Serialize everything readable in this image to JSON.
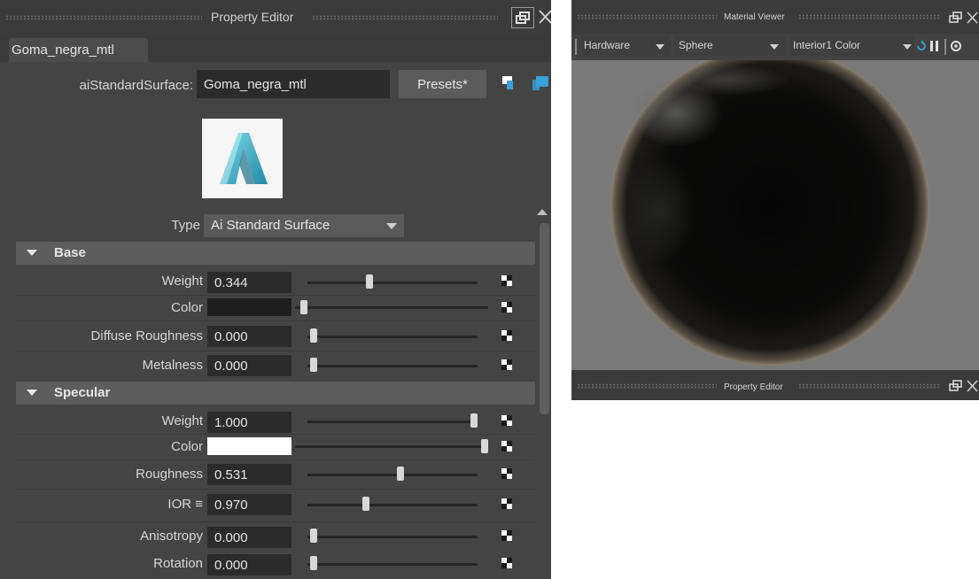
{
  "property_editor": {
    "title": "Property Editor",
    "tab_label": "Goma_negra_mtl",
    "node_type_label": "aiStandardSurface:",
    "node_name": "Goma_negra_mtl",
    "presets_label": "Presets*",
    "type_label": "Type",
    "type_value": "Ai Standard Surface",
    "sections": {
      "base": {
        "title": "Base",
        "weight": {
          "label": "Weight",
          "value": "0.344",
          "fraction": 0.344
        },
        "color": {
          "label": "Color",
          "swatch": "#1f1f1f",
          "fraction": 0.0
        },
        "diffuse_roughness": {
          "label": "Diffuse Roughness",
          "value": "0.000",
          "fraction": 0.0
        },
        "metalness": {
          "label": "Metalness",
          "value": "0.000",
          "fraction": 0.0
        }
      },
      "specular": {
        "title": "Specular",
        "weight": {
          "label": "Weight",
          "value": "1.000",
          "fraction": 1.0
        },
        "color": {
          "label": "Color",
          "swatch": "#ffffff",
          "fraction": 1.0
        },
        "roughness": {
          "label": "Roughness",
          "value": "0.531",
          "fraction": 0.531
        },
        "ior": {
          "label": "IOR ≡",
          "value": "0.970",
          "fraction": 0.32
        },
        "anisotropy": {
          "label": "Anisotropy",
          "value": "0.000",
          "fraction": 0.0
        },
        "rotation": {
          "label": "Rotation",
          "value": "0.000",
          "fraction": 0.0
        }
      }
    }
  },
  "material_viewer": {
    "title": "Material Viewer",
    "renderer": "Hardware",
    "shape": "Sphere",
    "environment": "Interior1 Color",
    "bottom_title": "Property Editor"
  },
  "colors": {
    "panel_bg": "#444444",
    "field_bg": "#2b2b2b",
    "section_bg": "#5d5d5d",
    "accent_blue": "#3aa0d8"
  }
}
